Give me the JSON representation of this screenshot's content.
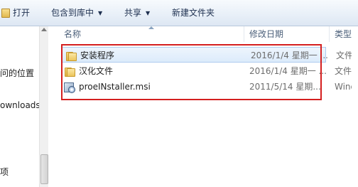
{
  "toolbar": {
    "open_label": "打开",
    "include_label": "包含到库中",
    "share_label": "共享",
    "new_folder_label": "新建文件夹",
    "caret": "▼"
  },
  "nav": {
    "item_1": "问的位置",
    "item_2": "ownloads",
    "item_3": "项"
  },
  "columns": {
    "name": "名称",
    "date": "修改日期",
    "type": "类型"
  },
  "files": [
    {
      "name": "安装程序",
      "date": "2016/1/4 星期一 ...",
      "type": "文件夹",
      "icon": "folder-icon",
      "selected": true
    },
    {
      "name": "汉化文件",
      "date": "2016/1/4 星期一 ...",
      "type": "文件夹",
      "icon": "folder-icon",
      "selected": false
    },
    {
      "name": "proeINstaller.msi",
      "date": "2011/5/14 星期...",
      "type": "Windo",
      "icon": "msi-icon",
      "selected": false
    }
  ],
  "colors": {
    "toolbar_bg": "#e9f0f8",
    "selection": "#dcebfb",
    "annotation_red": "#d41f1f"
  }
}
